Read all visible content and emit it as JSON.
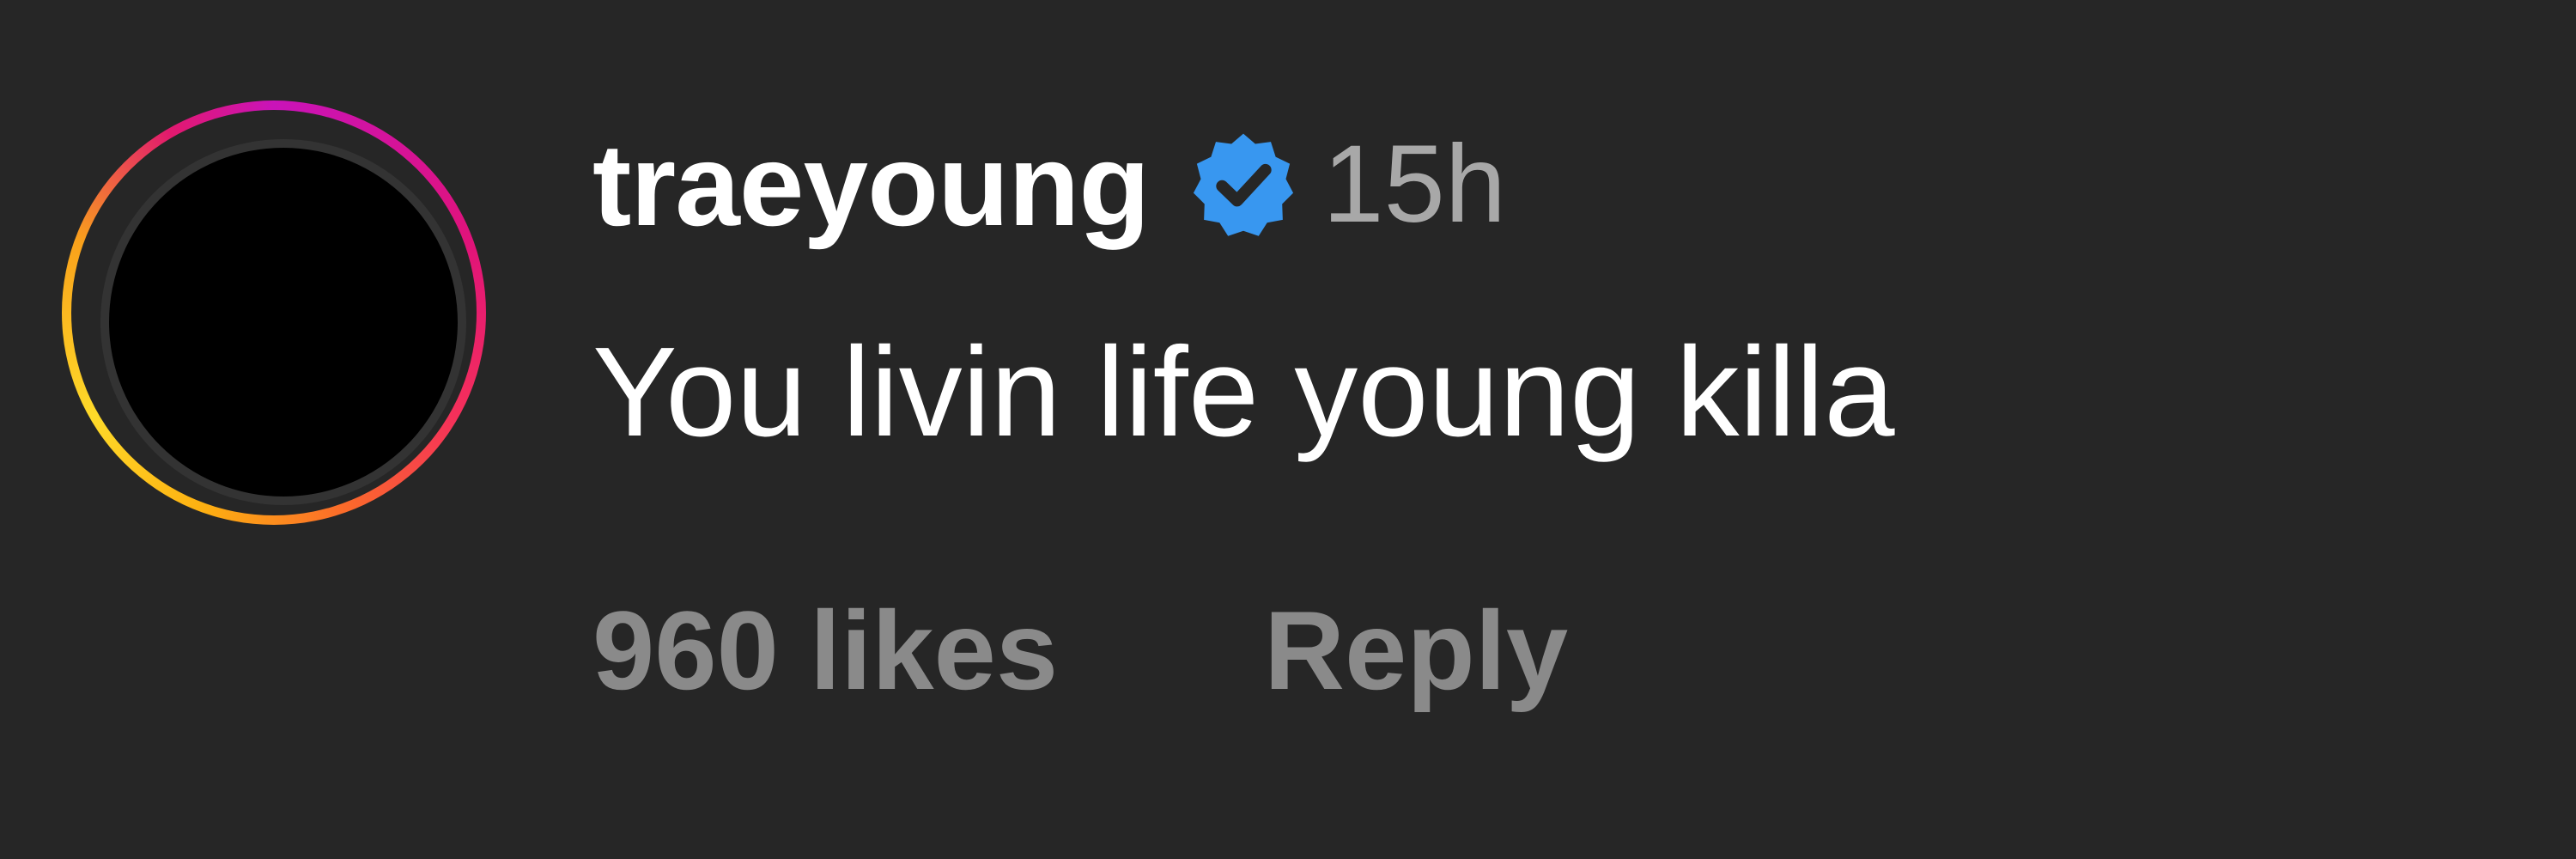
{
  "comment": {
    "username": "traeyoung",
    "verified_icon": "verified-badge-icon",
    "timestamp": "15h",
    "text": "You livin life young killa",
    "likes_label": "960 likes",
    "reply_label": "Reply"
  },
  "colors": {
    "background": "#262626",
    "username": "#ffffff",
    "timestamp": "#a8a8a8",
    "actions": "#8a8a8a",
    "verified_badge": "#3897f0",
    "story_ring_start": "#c913b9",
    "story_ring_end": "#feda29"
  }
}
